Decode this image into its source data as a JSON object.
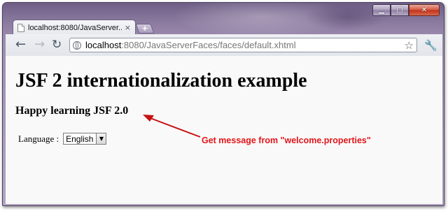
{
  "browser": {
    "tab_title": "localhost:8080/JavaServer...",
    "tab_close": "×",
    "new_tab": "+",
    "url_host": "localhost",
    "url_rest": ":8080/JavaServerFaces/faces/default.xhtml",
    "controls": {
      "minimize": "▁",
      "maximize": "▢",
      "close": "✕"
    }
  },
  "page": {
    "heading": "JSF 2 internationalization example",
    "message": "Happy learning JSF 2.0",
    "language_label": "Language :",
    "language_selected": "English"
  },
  "annotation": {
    "text": "Get message from \"welcome.properties\"",
    "color": "#e4161a"
  }
}
